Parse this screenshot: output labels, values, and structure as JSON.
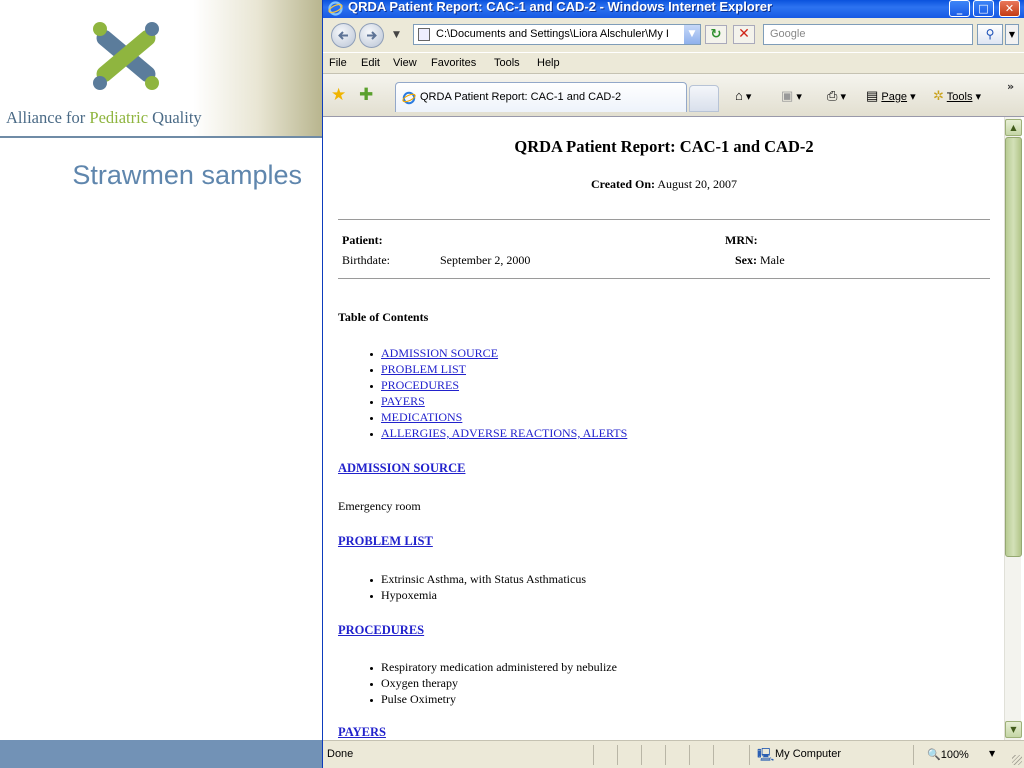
{
  "slide": {
    "logo_text_part1": "Alliance for ",
    "logo_text_accent": "Pediatric",
    "logo_text_part2": " Quality",
    "subtitle": "Strawmen samples",
    "colors": {
      "logo_blue": "#5b7c9b",
      "logo_green": "#8fb53f",
      "subtitle": "#5f86ad",
      "footer": "#7292b6"
    }
  },
  "window": {
    "title": "QRDA Patient Report: CAC-1 and CAD-2 - Windows Internet Explorer",
    "address": "C:\\Documents and Settings\\Liora Alschuler\\My I",
    "search_placeholder": "Google"
  },
  "menu": [
    "File",
    "Edit",
    "View",
    "Favorites",
    "Tools",
    "Help"
  ],
  "tab": {
    "label": "QRDA Patient Report: CAC-1 and CAD-2"
  },
  "toolbar": {
    "page_label": "Page",
    "tools_label": "Tools",
    "chevron": "»"
  },
  "doc": {
    "title": "QRDA Patient Report: CAC-1 and CAD-2",
    "created_label": "Created On:",
    "created_value": "August 20, 2007",
    "patient_label": "Patient:",
    "patient_value": "",
    "mrn_label": "MRN:",
    "mrn_value": "",
    "birthdate_label": "Birthdate:",
    "birthdate_value": "September 2, 2000",
    "sex_label": "Sex:",
    "sex_value": "Male",
    "toc_heading": "Table of Contents",
    "toc": [
      "ADMISSION SOURCE",
      "PROBLEM LIST",
      "PROCEDURES",
      "PAYERS",
      "MEDICATIONS",
      "ALLERGIES, ADVERSE REACTIONS, ALERTS"
    ],
    "admission_heading": "ADMISSION SOURCE",
    "admission_value": "Emergency room",
    "problem_heading": "PROBLEM LIST",
    "problems": [
      "Extrinsic Asthma, with Status Asthmaticus",
      "Hypoxemia"
    ],
    "procedures_heading": "PROCEDURES",
    "procedures": [
      "Respiratory medication administered by nebulize",
      "Oxygen therapy",
      "Pulse Oximetry"
    ],
    "payers_heading": "PAYERS"
  },
  "status": {
    "text": "Done",
    "zone": "My Computer",
    "zoom": "100%"
  },
  "icons": [
    "ie-logo-icon",
    "back-arrow-icon",
    "forward-arrow-icon",
    "page-icon",
    "refresh-icon",
    "stop-icon",
    "search-icon",
    "favorites-star-icon",
    "add-favorite-icon",
    "home-icon",
    "feeds-icon",
    "print-icon",
    "page-menu-icon",
    "tools-gear-icon",
    "computer-zone-icon",
    "zoom-icon"
  ]
}
